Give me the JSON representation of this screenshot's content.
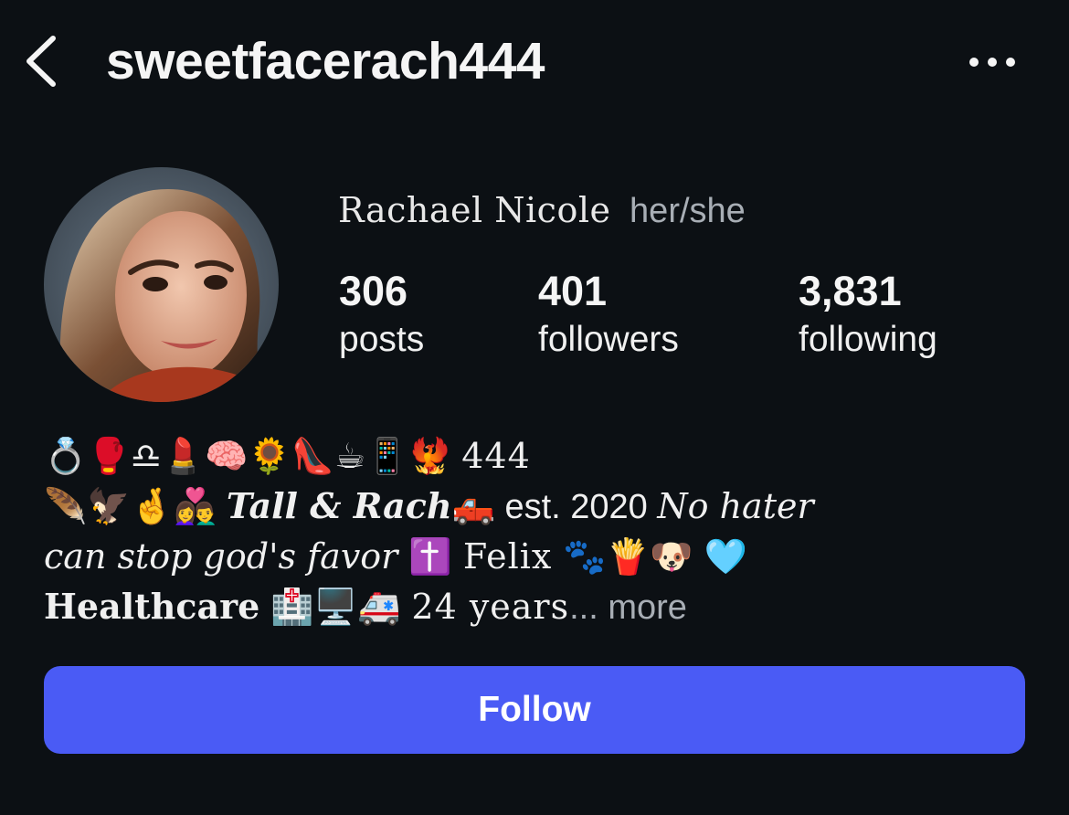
{
  "header": {
    "username": "sweetfacerach444"
  },
  "profile": {
    "full_name": "Rachael Nicole",
    "pronouns": "her/she",
    "stats": {
      "posts": {
        "value": "306",
        "label": "posts"
      },
      "followers": {
        "value": "401",
        "label": "followers"
      },
      "following": {
        "value": "3,831",
        "label": "following"
      }
    }
  },
  "bio": {
    "line1": {
      "emojis": "💍🥊♎💄🧠🌻👠☕📱🐦‍🔥",
      "text": "444"
    },
    "line2": {
      "emojis_a": "🪶🦅🤞👩‍❤️‍👨",
      "styled": "Tall & Rach",
      "emoji_b": "🛻",
      "plain": " est. 2020 ",
      "styled2": "No hater"
    },
    "line3": {
      "styled": "can stop god's favor",
      "emoji_a": " ✝️ ",
      "outline": "Felix",
      "emojis_b": " 🐾🍟🐶 🩵"
    },
    "line4": {
      "bold": "Healthcare",
      "emojis": " 🏥🖥️🚑 ",
      "text": "24 years",
      "ellipsis": "...",
      "more": " more"
    }
  },
  "actions": {
    "follow_label": "Follow"
  },
  "icons": {
    "back": "chevron-left-icon",
    "more": "ellipsis-icon"
  },
  "colors": {
    "background": "#0c1014",
    "follow_button": "#4a5bf5",
    "secondary_text": "#a8aeb5"
  }
}
